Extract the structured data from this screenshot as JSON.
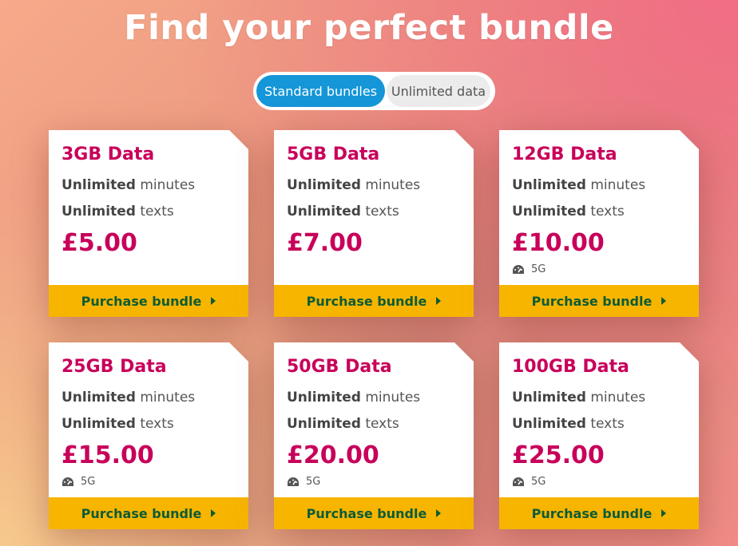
{
  "header": {
    "title": "Find your perfect bundle"
  },
  "toggle": {
    "active_label": "Standard bundles",
    "inactive_label": "Unlimited data"
  },
  "labels": {
    "unlimited": "Unlimited",
    "minutes": "minutes",
    "texts": "texts",
    "purchase": "Purchase bundle"
  },
  "bundles": [
    {
      "name": "3GB Data",
      "price": "£5.00",
      "badge": ""
    },
    {
      "name": "5GB Data",
      "price": "£7.00",
      "badge": ""
    },
    {
      "name": "12GB Data",
      "price": "£10.00",
      "badge": "5G"
    },
    {
      "name": "25GB Data",
      "price": "£15.00",
      "badge": "5G"
    },
    {
      "name": "50GB Data",
      "price": "£20.00",
      "badge": "5G"
    },
    {
      "name": "100GB Data",
      "price": "£25.00",
      "badge": "5G"
    }
  ],
  "colors": {
    "accent": "#c8005a",
    "button": "#f7b500",
    "button_text": "#0d5b36",
    "toggle_active": "#1496d8"
  },
  "icons": {
    "badge_icon": "speedometer-icon",
    "button_icon": "chevron-right-icon"
  }
}
